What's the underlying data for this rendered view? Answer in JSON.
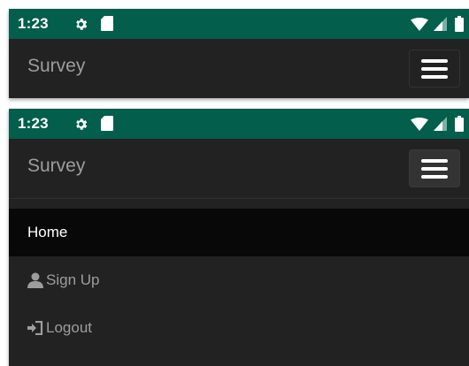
{
  "status": {
    "time": "1:23"
  },
  "navbar": {
    "brand": "Survey"
  },
  "menu": {
    "items": [
      {
        "label": "Home",
        "active": true,
        "icon": ""
      },
      {
        "label": "Sign Up",
        "active": false,
        "icon": "user-icon"
      },
      {
        "label": "Logout",
        "active": false,
        "icon": "logout-icon"
      }
    ]
  },
  "colors": {
    "status_bar": "#035e4c",
    "navbar": "#222222",
    "active_item": "#080808",
    "muted_text": "#9d9d9d"
  }
}
